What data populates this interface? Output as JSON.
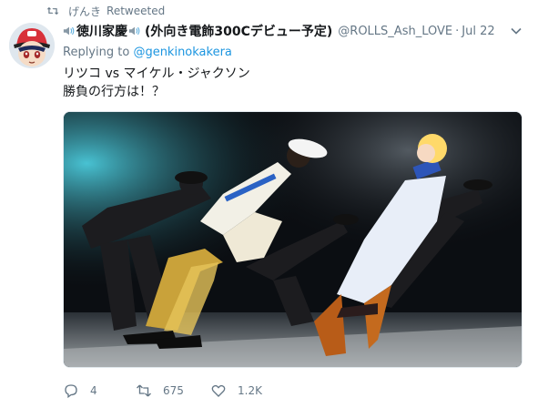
{
  "retweet_bar": {
    "icon": "retweet-icon",
    "user": "げんき",
    "label": "Retweeted"
  },
  "tweet": {
    "avatar": "avatar",
    "display_name": "徳川家慶",
    "display_name_suffix": "(外向き電飾300Cデビュー予定)",
    "handle": "@ROLLS_Ash_LOVE",
    "separator": "·",
    "date": "Jul 22",
    "replying_to_label": "Replying to",
    "replying_to_user": "@genkinokakera",
    "text_line1": "リツコ vs マイケル・ジャクソン",
    "text_line2": "勝負の行方は！？",
    "media_icon": "dance-photo"
  },
  "actions": {
    "reply_count": "4",
    "retweet_count": "675",
    "like_count": "1.2K"
  },
  "colors": {
    "link": "#1b95e0",
    "muted": "#657786",
    "text": "#14171a"
  }
}
